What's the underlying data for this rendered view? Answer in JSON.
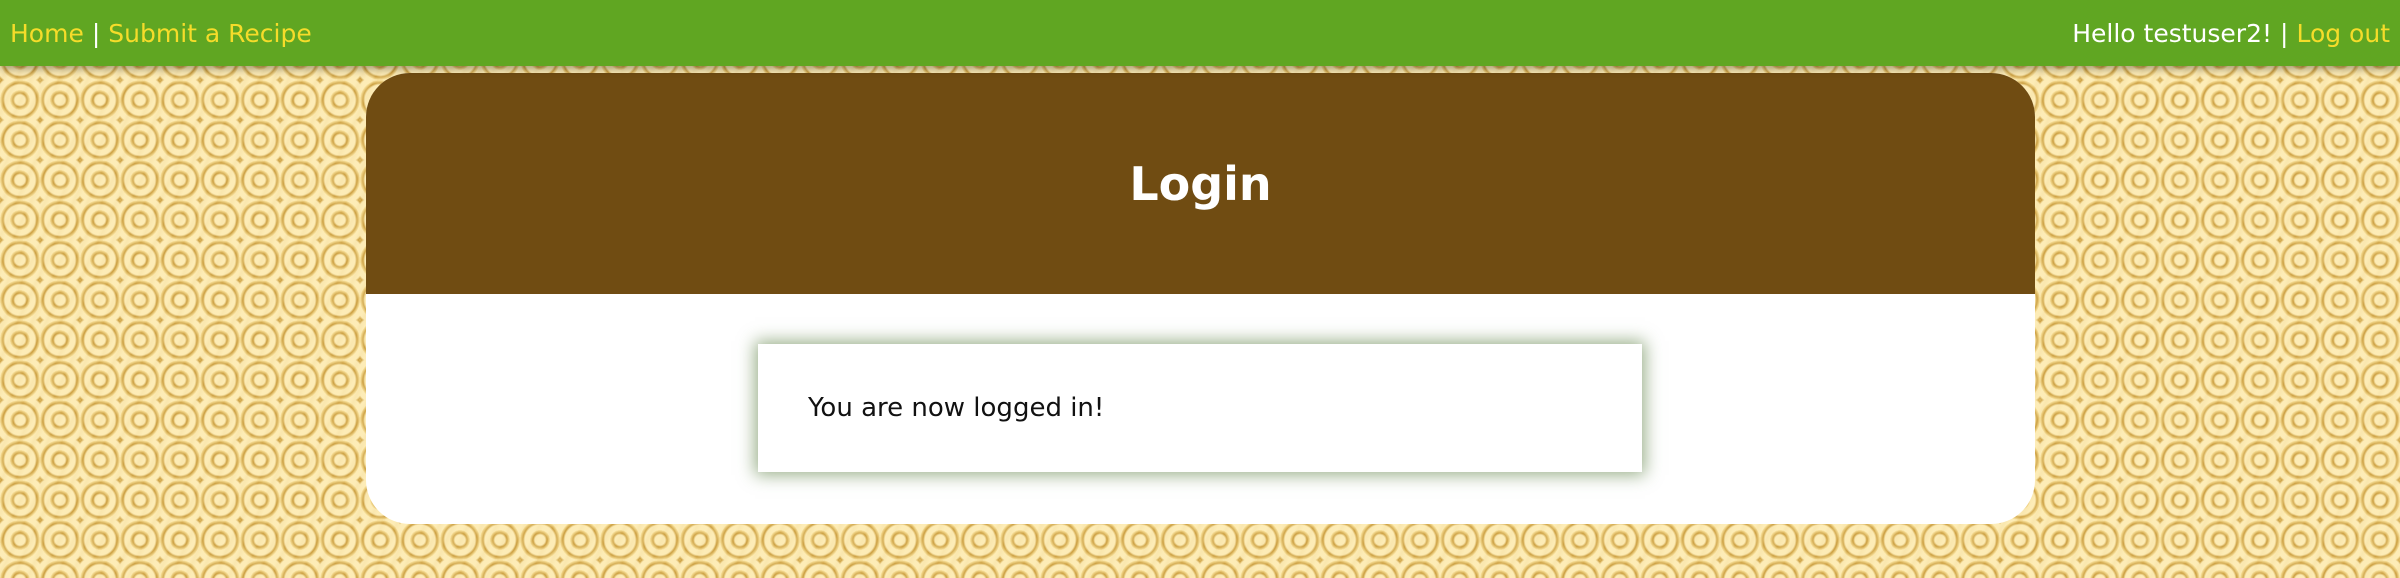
{
  "nav": {
    "home_label": "Home",
    "separator": "|",
    "submit_label": "Submit a Recipe",
    "greeting": "Hello testuser2!",
    "logout_label": "Log out"
  },
  "card": {
    "title": "Login",
    "message": "You are now logged in!"
  },
  "colors": {
    "nav_bg": "#60a622",
    "nav_link": "#f5dc2a",
    "header_bg": "#704c12",
    "page_bg": "#e8c46a"
  }
}
